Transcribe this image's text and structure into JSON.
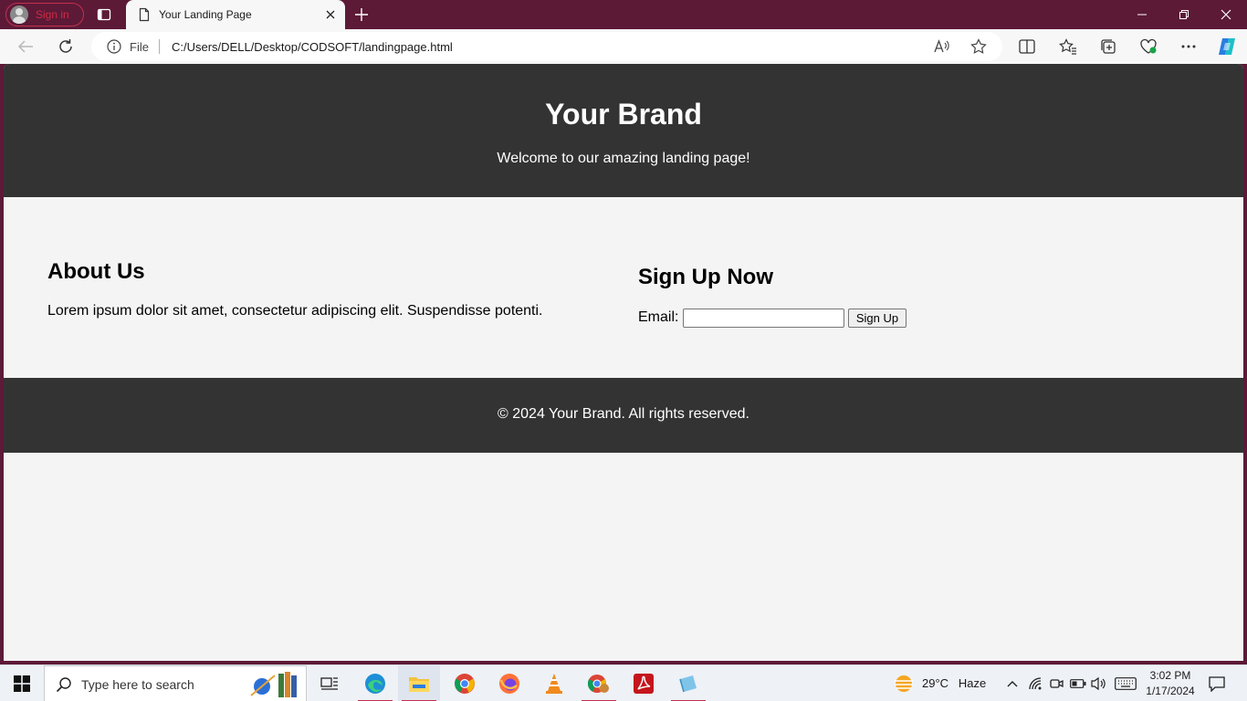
{
  "browser": {
    "profile_label": "Sign in",
    "tab_title": "Your Landing Page",
    "address_scheme": "File",
    "address_url": "C:/Users/DELL/Desktop/CODSOFT/landingpage.html"
  },
  "page": {
    "brand": "Your Brand",
    "tagline": "Welcome to our amazing landing page!",
    "about_title": "About Us",
    "about_text": "Lorem ipsum dolor sit amet, consectetur adipiscing elit. Suspendisse potenti.",
    "signup_title": "Sign Up Now",
    "email_label": "Email:",
    "email_value": "",
    "signup_button": "Sign Up",
    "footer": "© 2024 Your Brand. All rights reserved."
  },
  "taskbar": {
    "search_placeholder": "Type here to search",
    "weather_temp": "29°C",
    "weather_desc": "Haze",
    "time": "3:02 PM",
    "date": "1/17/2024"
  },
  "colors": {
    "tabstrip": "#5c1a37",
    "header_footer": "#333333",
    "page_bg": "#f4f4f4",
    "accent": "#c0314f"
  }
}
